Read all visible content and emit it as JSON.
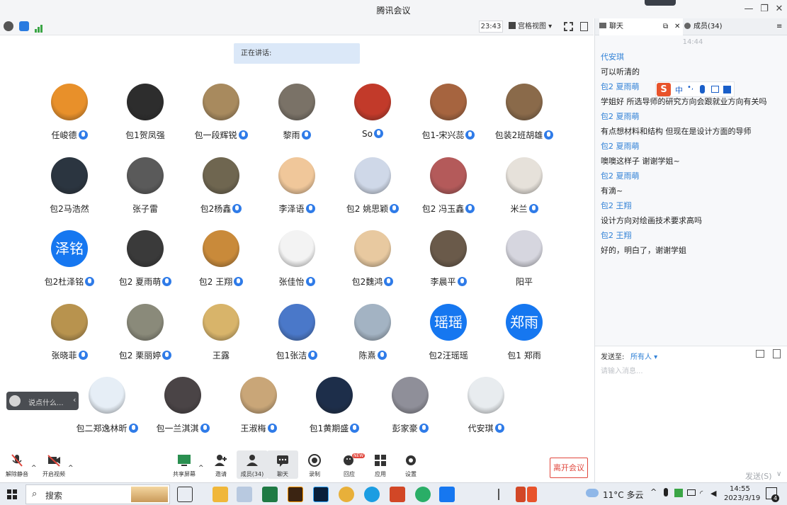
{
  "window": {
    "title": "腾讯会议"
  },
  "toolbar": {
    "time": "23:43",
    "view_label": "宫格视图 ▾"
  },
  "speaking": {
    "label": "正在讲话:"
  },
  "participants": [
    {
      "name": "任峻德",
      "avatar_color": "#e8902a",
      "mic": true
    },
    {
      "name": "包1贺凤强",
      "avatar_color": "#2d2d2d",
      "mic": false
    },
    {
      "name": "包一段辉锐",
      "avatar_color": "#a88a5e",
      "mic": true
    },
    {
      "name": "黎雨",
      "avatar_color": "#7a7267",
      "mic": true
    },
    {
      "name": "So",
      "avatar_color": "#c23a2a",
      "mic": true
    },
    {
      "name": "包1-宋兴蕊",
      "avatar_color": "#a6643f",
      "mic": true
    },
    {
      "name": "包装2班胡雄",
      "avatar_color": "#8a6a4a",
      "mic": true
    },
    {
      "name": "包2马浩然",
      "avatar_color": "#2b3540",
      "mic": false
    },
    {
      "name": "张子雷",
      "avatar_color": "#5a5a5a",
      "mic": false
    },
    {
      "name": "包2杨鑫",
      "avatar_color": "#6f6650",
      "mic": true
    },
    {
      "name": "李泽语",
      "avatar_color": "#f0c79a",
      "mic": true
    },
    {
      "name": "包2 姚思颖",
      "avatar_color": "#cfd8e8",
      "mic": true
    },
    {
      "name": "包2 冯玉鑫",
      "avatar_color": "#b45a5a",
      "mic": true
    },
    {
      "name": "米兰",
      "avatar_color": "#e6e1da",
      "mic": true
    },
    {
      "name": "包2杜泽铭",
      "avatar_text": "泽铭",
      "avatar_color": "#1677f0",
      "mic": true
    },
    {
      "name": "包2 夏雨萌",
      "avatar_color": "#3a3a3a",
      "mic": true
    },
    {
      "name": "包2 王翔",
      "avatar_color": "#c98a3a",
      "mic": true
    },
    {
      "name": "张佳怡",
      "avatar_color": "#f3f3f3",
      "mic": true
    },
    {
      "name": "包2魏鸿",
      "avatar_color": "#e8c9a0",
      "mic": true
    },
    {
      "name": "李晨平",
      "avatar_color": "#6a5a4a",
      "mic": true
    },
    {
      "name": "阳平",
      "avatar_color": "#d6d6df",
      "mic": false
    },
    {
      "name": "张晓菲",
      "avatar_color": "#b8934e",
      "mic": true
    },
    {
      "name": "包2 栗丽婷",
      "avatar_color": "#8a8a7a",
      "mic": true
    },
    {
      "name": "王露",
      "avatar_color": "#d8b46a",
      "mic": false
    },
    {
      "name": "包1张洁",
      "avatar_color": "#4a78c9",
      "mic": true
    },
    {
      "name": "陈熹",
      "avatar_color": "#a3b3c3",
      "mic": true
    },
    {
      "name": "包2汪瑶瑶",
      "avatar_text": "瑶瑶",
      "avatar_color": "#1677f0",
      "mic": false
    },
    {
      "name": "包1 郑雨",
      "avatar_text": "郑雨",
      "avatar_color": "#1677f0",
      "mic": false
    },
    {
      "name": "包二郑逸林昕",
      "avatar_color": "#e6eef6",
      "mic": true
    },
    {
      "name": "包一兰淇淇",
      "avatar_color": "#4a4446",
      "mic": true
    },
    {
      "name": "王淑梅",
      "avatar_color": "#c9a678",
      "mic": true
    },
    {
      "name": "包1黄期盛",
      "avatar_color": "#1d2e4a",
      "mic": true
    },
    {
      "name": "彭家豪",
      "avatar_color": "#8f8f99",
      "mic": true
    },
    {
      "name": "代安琪",
      "avatar_color": "#e8ecef",
      "mic": true
    }
  ],
  "say_something": {
    "placeholder": "说点什么..."
  },
  "controls": {
    "unmute": "解除静音",
    "start_video": "开启视频",
    "share_screen": "共享屏幕",
    "invite": "邀请",
    "members": "成员(34)",
    "chat": "聊天",
    "record": "录制",
    "apps_new": "回应",
    "apps": "应用",
    "settings": "设置",
    "leave": "离开会议",
    "new_badge": "NEW"
  },
  "side_panel": {
    "chat_tab": "聊天",
    "members_tab": "成员(34)",
    "time": "14:44",
    "messages": [
      {
        "sender": "代安琪",
        "text": "可以听清的"
      },
      {
        "sender": "包2 夏雨萌",
        "text": "学姐好 所选导师的研究方向会跟就业方向有关吗"
      },
      {
        "sender": "包2 夏雨萌",
        "text": "有点想材料和结构 但现在是设计方面的导师"
      },
      {
        "sender": "包2 夏雨萌",
        "text": "噢噢这样子 谢谢学姐~"
      },
      {
        "sender": "包2 夏雨萌",
        "text": "有滴~"
      },
      {
        "sender": "包2 王翔",
        "text": "设计方向对绘画技术要求高吗"
      },
      {
        "sender": "包2 王翔",
        "text": "好的，明白了，谢谢学姐"
      }
    ],
    "ime_label": "中",
    "send_to_label": "发送至:",
    "send_to_value": "所有人 ▾",
    "input_placeholder": "请输入消息...",
    "send_button": "发送(S)"
  },
  "taskbar": {
    "search_placeholder": "搜索",
    "weather": "11°C 多云",
    "time": "14:55",
    "date": "2023/3/19",
    "notification_count": "4"
  }
}
